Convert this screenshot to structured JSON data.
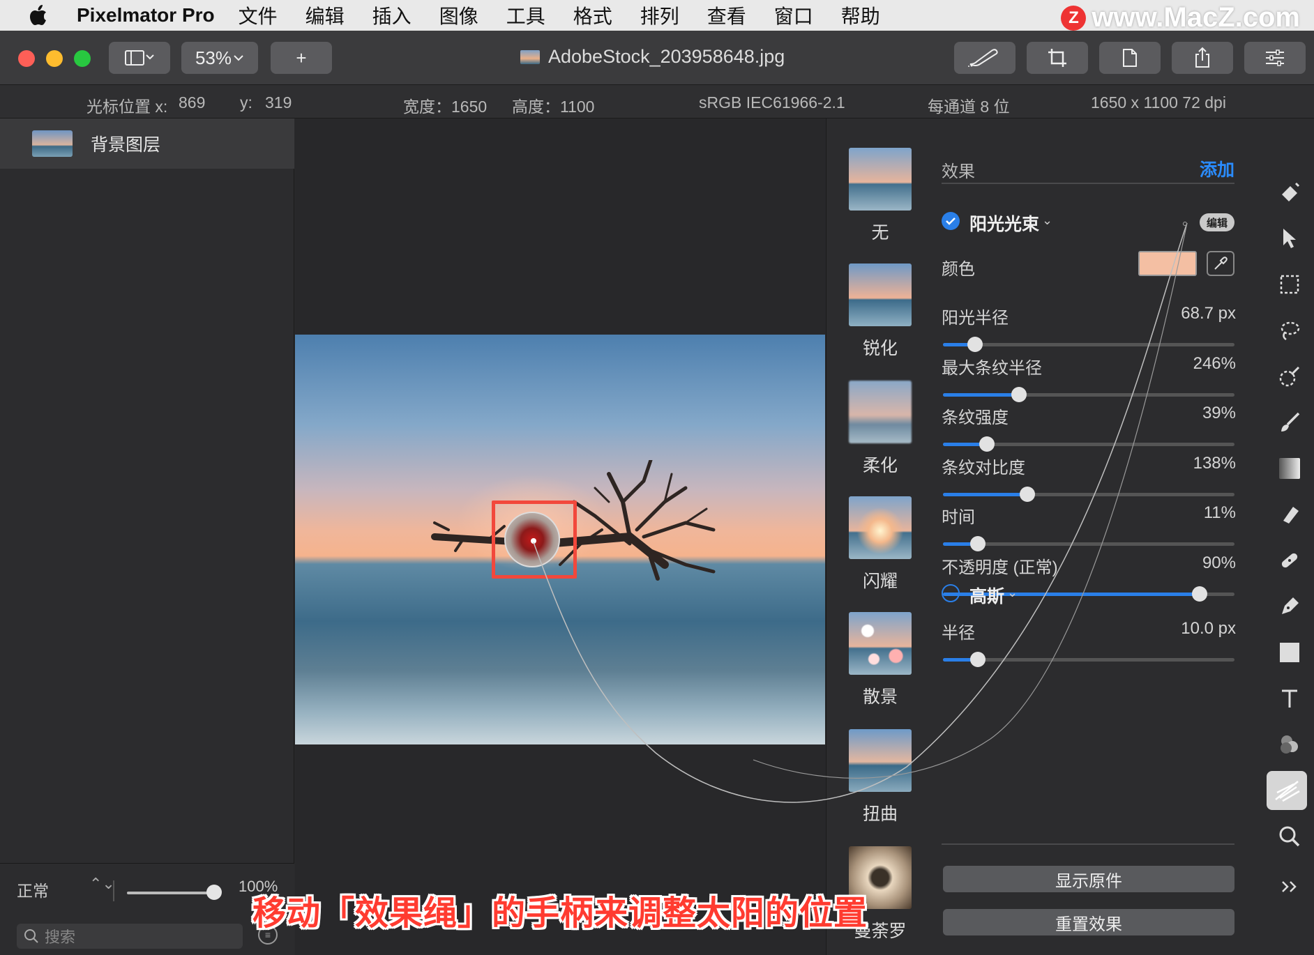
{
  "menubar": {
    "app_name": "Pixelmator Pro",
    "items": [
      "文件",
      "编辑",
      "插入",
      "图像",
      "工具",
      "格式",
      "排列",
      "查看",
      "窗口",
      "帮助"
    ],
    "watermark": "www.MacZ.com",
    "watermark_badge": "Z"
  },
  "toolbar": {
    "zoom": "53%",
    "add_label": "+",
    "document_title": "AdobeStock_203958648.jpg"
  },
  "infobar": {
    "cursor_label": "光标位置 x:",
    "cursor_x": "869",
    "cursor_y_label": "y:",
    "cursor_y": "319",
    "width": "宽度：1650",
    "height": "高度：1100",
    "color_profile": "sRGB IEC61966-2.1",
    "bit_depth": "每通道 8 位",
    "dimensions": "1650 x 1100 72 dpi"
  },
  "layers": {
    "items": [
      {
        "name": "背景图层"
      }
    ],
    "blend_mode": "正常",
    "opacity": "100%",
    "opacity_level": 1.0,
    "search_placeholder": "搜索"
  },
  "presets": [
    {
      "label": "无",
      "icon": "preset-none"
    },
    {
      "label": "锐化",
      "icon": "preset-sharpen"
    },
    {
      "label": "柔化",
      "icon": "preset-soften"
    },
    {
      "label": "闪耀",
      "icon": "preset-shine"
    },
    {
      "label": "散景",
      "icon": "preset-bokeh"
    },
    {
      "label": "扭曲",
      "icon": "preset-distort"
    },
    {
      "label": "曼荼罗",
      "icon": "preset-mandala"
    }
  ],
  "effects": {
    "header": "效果",
    "add_label": "添加",
    "sunbeams": {
      "name": "阳光光束",
      "enabled": true,
      "edit_label": "编辑",
      "color_label": "颜色",
      "color_value": "#f4bfa3",
      "params": [
        {
          "label": "阳光半径",
          "value": "68.7 px",
          "level": 0.11
        },
        {
          "label": "最大条纹半径",
          "value": "246%",
          "level": 0.26
        },
        {
          "label": "条纹强度",
          "value": "39%",
          "level": 0.15
        },
        {
          "label": "条纹对比度",
          "value": "138%",
          "level": 0.29
        },
        {
          "label": "时间",
          "value": "11%",
          "level": 0.12
        },
        {
          "label": "不透明度 (正常)",
          "value": "90%",
          "level": 0.88
        }
      ]
    },
    "gaussian": {
      "name": "高斯",
      "enabled": false,
      "params": [
        {
          "label": "半径",
          "value": "10.0 px",
          "level": 0.12
        }
      ]
    },
    "show_original": "显示原件",
    "reset_effects": "重置效果"
  },
  "caption": "移动「效果绳」的手柄来调整太阳的位置",
  "colors": {
    "accent": "#2a8cff",
    "highlight_box": "#f2483c",
    "caption": "#ff3b30"
  }
}
